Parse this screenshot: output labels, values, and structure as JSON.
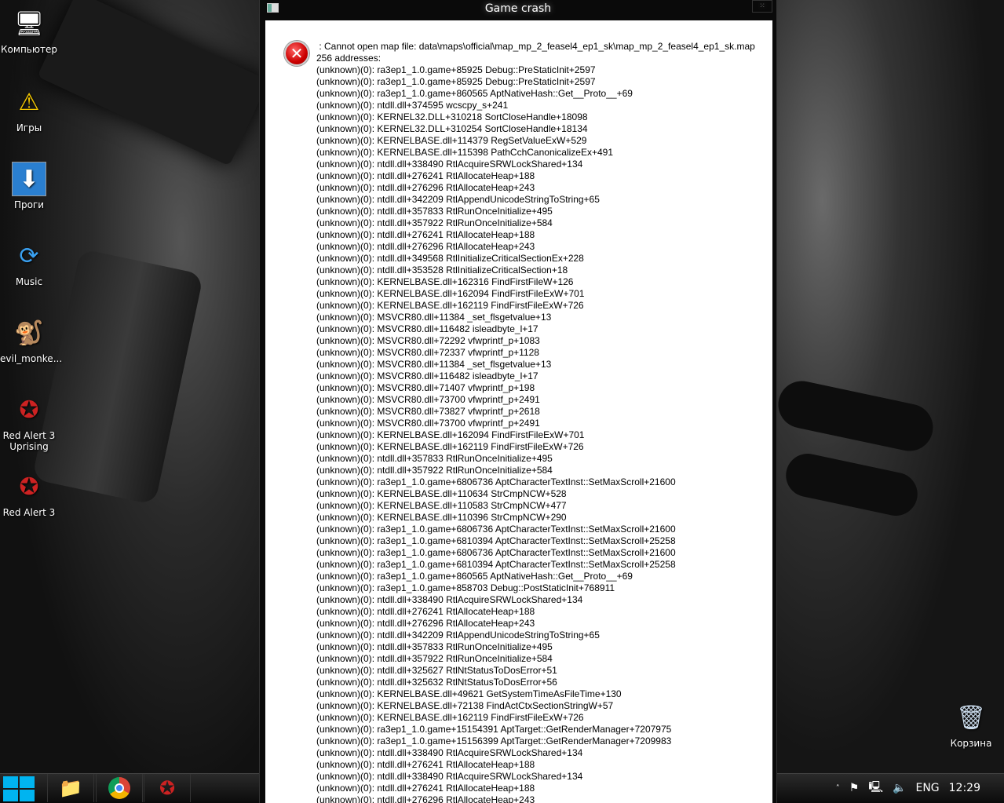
{
  "desktop": {
    "icons": [
      {
        "label": "Компьютер",
        "icon": "computer-icon"
      },
      {
        "label": "Игры",
        "icon": "warning-icon"
      },
      {
        "label": "Проги",
        "icon": "download-icon"
      },
      {
        "label": "Music",
        "icon": "sync-icon"
      },
      {
        "label": "evil_monke...",
        "icon": "monkey-icon"
      },
      {
        "label": "Red Alert 3 Uprising",
        "icon": "red-alert-icon"
      },
      {
        "label": "Red Alert 3",
        "icon": "red-alert-icon"
      },
      {
        "label": "Корзина",
        "icon": "recycle-bin-icon"
      }
    ]
  },
  "window": {
    "title": "Game crash",
    "resize_glyph": "⁙",
    "message_lines": [
      " : Cannot open map file: data\\maps\\official\\map_mp_2_feasel4_ep1_sk\\map_mp_2_feasel4_ep1_sk.map",
      "256 addresses:",
      "(unknown)(0): ra3ep1_1.0.game+85925 Debug::PreStaticInit+2597",
      "(unknown)(0): ra3ep1_1.0.game+85925 Debug::PreStaticInit+2597",
      "(unknown)(0): ra3ep1_1.0.game+860565 AptNativeHash::Get__Proto__+69",
      "(unknown)(0): ntdll.dll+374595 wcscpy_s+241",
      "(unknown)(0): KERNEL32.DLL+310218 SortCloseHandle+18098",
      "(unknown)(0): KERNEL32.DLL+310254 SortCloseHandle+18134",
      "(unknown)(0): KERNELBASE.dll+114379 RegSetValueExW+529",
      "(unknown)(0): KERNELBASE.dll+115398 PathCchCanonicalizeEx+491",
      "(unknown)(0): ntdll.dll+338490 RtlAcquireSRWLockShared+134",
      "(unknown)(0): ntdll.dll+276241 RtlAllocateHeap+188",
      "(unknown)(0): ntdll.dll+276296 RtlAllocateHeap+243",
      "(unknown)(0): ntdll.dll+342209 RtlAppendUnicodeStringToString+65",
      "(unknown)(0): ntdll.dll+357833 RtlRunOnceInitialize+495",
      "(unknown)(0): ntdll.dll+357922 RtlRunOnceInitialize+584",
      "(unknown)(0): ntdll.dll+276241 RtlAllocateHeap+188",
      "(unknown)(0): ntdll.dll+276296 RtlAllocateHeap+243",
      "(unknown)(0): ntdll.dll+349568 RtlInitializeCriticalSectionEx+228",
      "(unknown)(0): ntdll.dll+353528 RtlInitializeCriticalSection+18",
      "(unknown)(0): KERNELBASE.dll+162316 FindFirstFileW+126",
      "(unknown)(0): KERNELBASE.dll+162094 FindFirstFileExW+701",
      "(unknown)(0): KERNELBASE.dll+162119 FindFirstFileExW+726",
      "(unknown)(0): MSVCR80.dll+11384 _set_flsgetvalue+13",
      "(unknown)(0): MSVCR80.dll+116482 isleadbyte_l+17",
      "(unknown)(0): MSVCR80.dll+72292 vfwprintf_p+1083",
      "(unknown)(0): MSVCR80.dll+72337 vfwprintf_p+1128",
      "(unknown)(0): MSVCR80.dll+11384 _set_flsgetvalue+13",
      "(unknown)(0): MSVCR80.dll+116482 isleadbyte_l+17",
      "(unknown)(0): MSVCR80.dll+71407 vfwprintf_p+198",
      "(unknown)(0): MSVCR80.dll+73700 vfwprintf_p+2491",
      "(unknown)(0): MSVCR80.dll+73827 vfwprintf_p+2618",
      "(unknown)(0): MSVCR80.dll+73700 vfwprintf_p+2491",
      "(unknown)(0): KERNELBASE.dll+162094 FindFirstFileExW+701",
      "(unknown)(0): KERNELBASE.dll+162119 FindFirstFileExW+726",
      "(unknown)(0): ntdll.dll+357833 RtlRunOnceInitialize+495",
      "(unknown)(0): ntdll.dll+357922 RtlRunOnceInitialize+584",
      "(unknown)(0): ra3ep1_1.0.game+6806736 AptCharacterTextInst::SetMaxScroll+21600",
      "(unknown)(0): KERNELBASE.dll+110634 StrCmpNCW+528",
      "(unknown)(0): KERNELBASE.dll+110583 StrCmpNCW+477",
      "(unknown)(0): KERNELBASE.dll+110396 StrCmpNCW+290",
      "(unknown)(0): ra3ep1_1.0.game+6806736 AptCharacterTextInst::SetMaxScroll+21600",
      "(unknown)(0): ra3ep1_1.0.game+6810394 AptCharacterTextInst::SetMaxScroll+25258",
      "(unknown)(0): ra3ep1_1.0.game+6806736 AptCharacterTextInst::SetMaxScroll+21600",
      "(unknown)(0): ra3ep1_1.0.game+6810394 AptCharacterTextInst::SetMaxScroll+25258",
      "(unknown)(0): ra3ep1_1.0.game+860565 AptNativeHash::Get__Proto__+69",
      "(unknown)(0): ra3ep1_1.0.game+858703 Debug::PostStaticInit+768911",
      "(unknown)(0): ntdll.dll+338490 RtlAcquireSRWLockShared+134",
      "(unknown)(0): ntdll.dll+276241 RtlAllocateHeap+188",
      "(unknown)(0): ntdll.dll+276296 RtlAllocateHeap+243",
      "(unknown)(0): ntdll.dll+342209 RtlAppendUnicodeStringToString+65",
      "(unknown)(0): ntdll.dll+357833 RtlRunOnceInitialize+495",
      "(unknown)(0): ntdll.dll+357922 RtlRunOnceInitialize+584",
      "(unknown)(0): ntdll.dll+325627 RtlNtStatusToDosError+51",
      "(unknown)(0): ntdll.dll+325632 RtlNtStatusToDosError+56",
      "(unknown)(0): KERNELBASE.dll+49621 GetSystemTimeAsFileTime+130",
      "(unknown)(0): KERNELBASE.dll+72138 FindActCtxSectionStringW+57",
      "(unknown)(0): KERNELBASE.dll+162119 FindFirstFileExW+726",
      "(unknown)(0): ra3ep1_1.0.game+15154391 AptTarget::GetRenderManager+7207975",
      "(unknown)(0): ra3ep1_1.0.game+15156399 AptTarget::GetRenderManager+7209983",
      "(unknown)(0): ntdll.dll+338490 RtlAcquireSRWLockShared+134",
      "(unknown)(0): ntdll.dll+276241 RtlAllocateHeap+188",
      "(unknown)(0): ntdll.dll+338490 RtlAcquireSRWLockShared+134",
      "(unknown)(0): ntdll.dll+276241 RtlAllocateHeap+188",
      "(unknown)(0): ntdll.dll+276296 RtlAllocateHeap+243"
    ]
  },
  "taskbar": {
    "apps": [
      "file-explorer-icon",
      "chrome-icon",
      "red-alert-icon"
    ],
    "tray": {
      "language": "ENG",
      "time": "12:29"
    }
  },
  "colors": {
    "accent": "#00b4f0",
    "error": "#cc0000"
  }
}
